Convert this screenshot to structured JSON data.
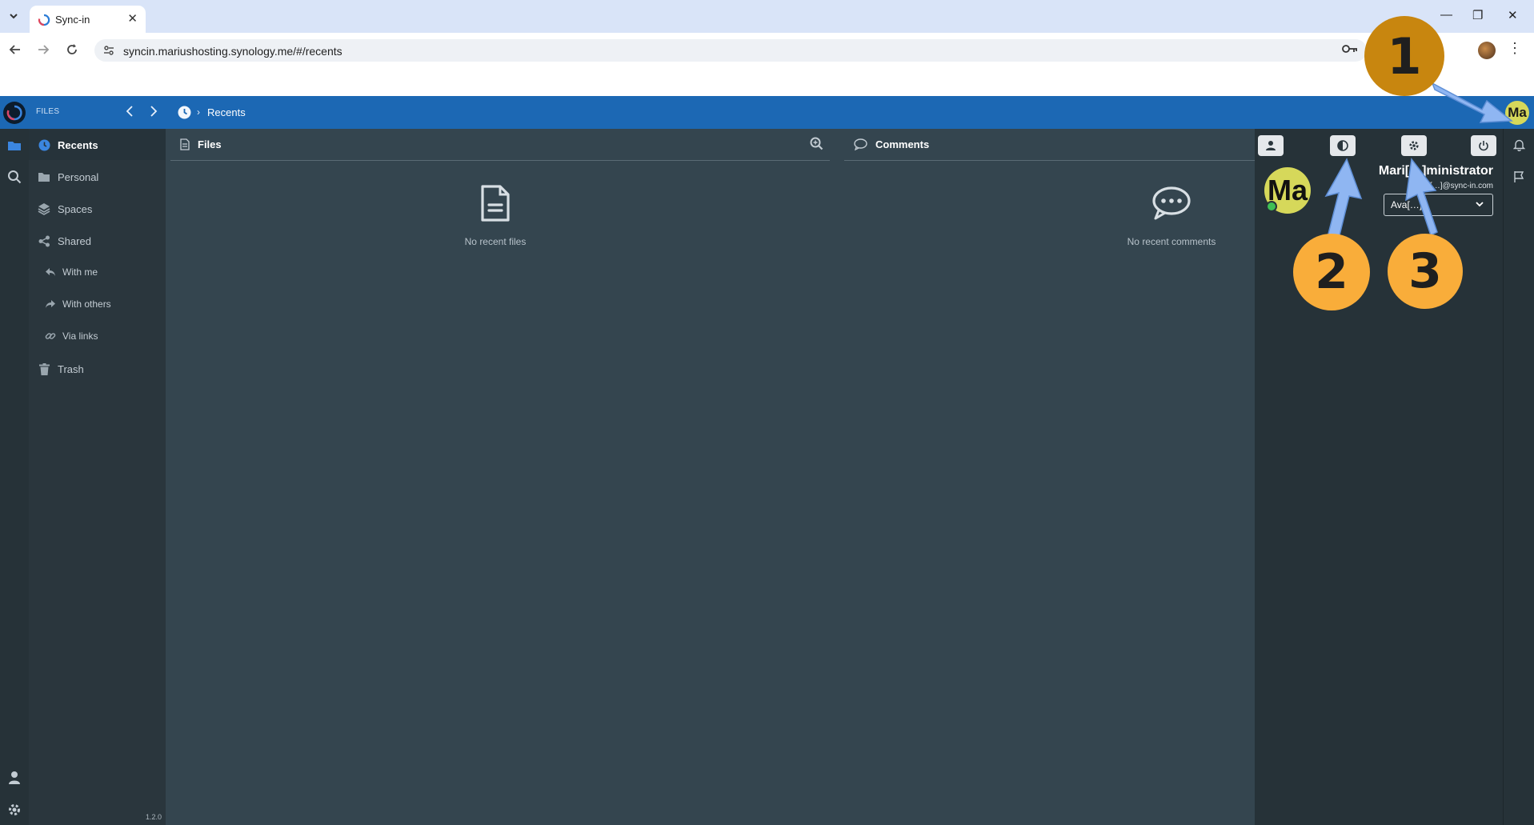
{
  "browser": {
    "tab_title": "Sync-in",
    "url": "syncin.mariushosting.synology.me/#/recents",
    "icons": {
      "tab_list": "chevron-down-icon",
      "close_tab": "close-icon",
      "back": "back-arrow-icon",
      "forward": "forward-arrow-icon",
      "reload": "reload-icon",
      "site_info": "site-settings-icon",
      "passwords": "key-icon",
      "menu": "kebab-menu-icon"
    }
  },
  "app_header": {
    "section_label": "FILES",
    "breadcrumb_current": "Recents",
    "avatar_initials": "Ma"
  },
  "sidebar": {
    "items": [
      {
        "label": "Recents",
        "icon": "clock-icon",
        "active": true
      },
      {
        "label": "Personal",
        "icon": "folder-icon"
      },
      {
        "label": "Spaces",
        "icon": "layers-icon"
      },
      {
        "label": "Shared",
        "icon": "share-icon"
      },
      {
        "label": "With me",
        "icon": "reply-icon",
        "sub": true
      },
      {
        "label": "With others",
        "icon": "forward-share-icon",
        "sub": true
      },
      {
        "label": "Via links",
        "icon": "link-icon",
        "sub": true
      },
      {
        "label": "Trash",
        "icon": "trash-icon"
      }
    ],
    "version": "1.2.0"
  },
  "files_pane": {
    "title": "Files",
    "empty_text": "No recent files"
  },
  "comments_pane": {
    "title": "Comments",
    "empty_text": "No recent comments"
  },
  "user_panel": {
    "avatar_initials": "Ma",
    "name": "Mari[…]ministrator",
    "email": "[…]@sync-in.com",
    "status_selected": "Ava[…]",
    "buttons": [
      "user-icon",
      "theme-contrast-icon",
      "gear-icon",
      "power-icon"
    ]
  },
  "annotations": {
    "badge_1": "1",
    "badge_2": "2",
    "badge_3": "3",
    "badge_1_color": "#c8860f",
    "badge_color": "#f9ad3a",
    "arrow_color": "#8fb6f2"
  },
  "colors": {
    "header_blue": "#1c68b4",
    "main_bg": "#34454f",
    "sidebar_bg": "#2a363d",
    "avatar": "#d6d85a",
    "status_online": "#3fbf55"
  }
}
